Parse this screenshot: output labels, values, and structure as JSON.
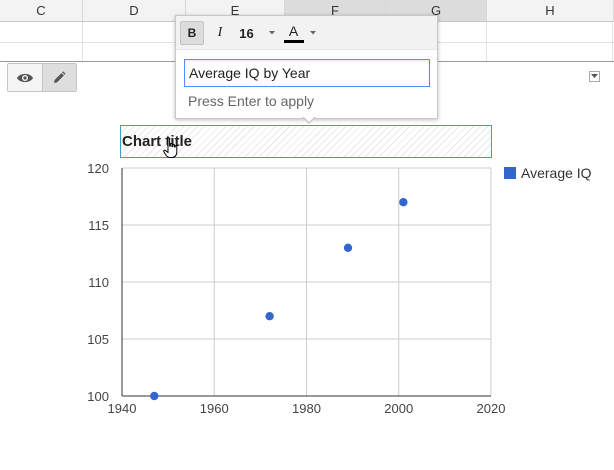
{
  "sheet": {
    "columns": [
      "C",
      "D",
      "E",
      "F",
      "G",
      "H"
    ]
  },
  "mode_toggle": {
    "view_icon": "eye-icon",
    "edit_icon": "pencil-icon"
  },
  "title_popup": {
    "bold_label": "B",
    "italic_label": "I",
    "font_size": "16",
    "text_color_label": "A",
    "text_color": "#000000",
    "input_value": "Average IQ by Year",
    "hint": "Press Enter to apply"
  },
  "chart_title": "Chart title",
  "chart_data": {
    "type": "scatter",
    "title": "Chart title",
    "xlabel": "",
    "ylabel": "",
    "xlim": [
      1940,
      2020
    ],
    "ylim": [
      100,
      120
    ],
    "x_ticks": [
      "1940",
      "1960",
      "1980",
      "2000",
      "2020"
    ],
    "y_ticks": [
      "100",
      "105",
      "110",
      "115",
      "120"
    ],
    "grid": true,
    "legend_position": "right",
    "series": [
      {
        "name": "Average IQ",
        "color": "#3366cc",
        "points": [
          {
            "x": 1947,
            "y": 100
          },
          {
            "x": 1972,
            "y": 107
          },
          {
            "x": 1989,
            "y": 113
          },
          {
            "x": 2001,
            "y": 117
          }
        ]
      }
    ]
  }
}
